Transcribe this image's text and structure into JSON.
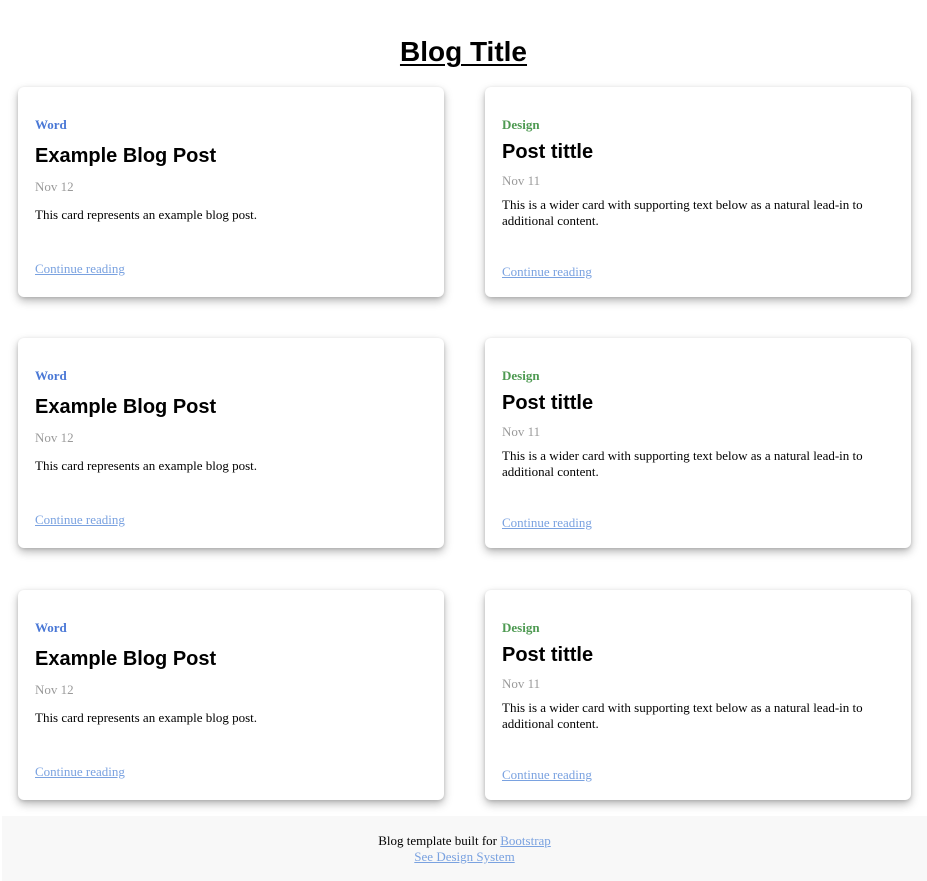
{
  "page": {
    "title": "Blog Title"
  },
  "colors": {
    "word_category": "#4a78d6",
    "design_category": "#4e9a52",
    "link": "#7aa2e0",
    "date": "#9a9a9a",
    "footer_bg": "#f8f8f8"
  },
  "cards": [
    {
      "category": "Word",
      "title": "Example Blog Post",
      "date": "Nov 12",
      "excerpt": "This card represents an example blog post.",
      "link": "Continue reading"
    },
    {
      "category": "Design",
      "title": "Post tittle",
      "date": "Nov 11",
      "excerpt": "This is a wider card with supporting text below as a natural lead-in to additional content.",
      "link": "Continue reading"
    },
    {
      "category": "Word",
      "title": "Example Blog Post",
      "date": "Nov 12",
      "excerpt": "This card represents an example blog post.",
      "link": "Continue reading"
    },
    {
      "category": "Design",
      "title": "Post tittle",
      "date": "Nov 11",
      "excerpt": "This is a wider card with supporting text below as a natural lead-in to additional content.",
      "link": "Continue reading"
    },
    {
      "category": "Word",
      "title": "Example Blog Post",
      "date": "Nov 12",
      "excerpt": "This card represents an example blog post.",
      "link": "Continue reading"
    },
    {
      "category": "Design",
      "title": "Post tittle",
      "date": "Nov 11",
      "excerpt": "This is a wider card with supporting text below as a natural lead-in to additional content.",
      "link": "Continue reading"
    }
  ],
  "footer": {
    "text": "Blog template built for",
    "bootstrap_link": "Bootstrap",
    "design_system_link": "See Design System"
  }
}
